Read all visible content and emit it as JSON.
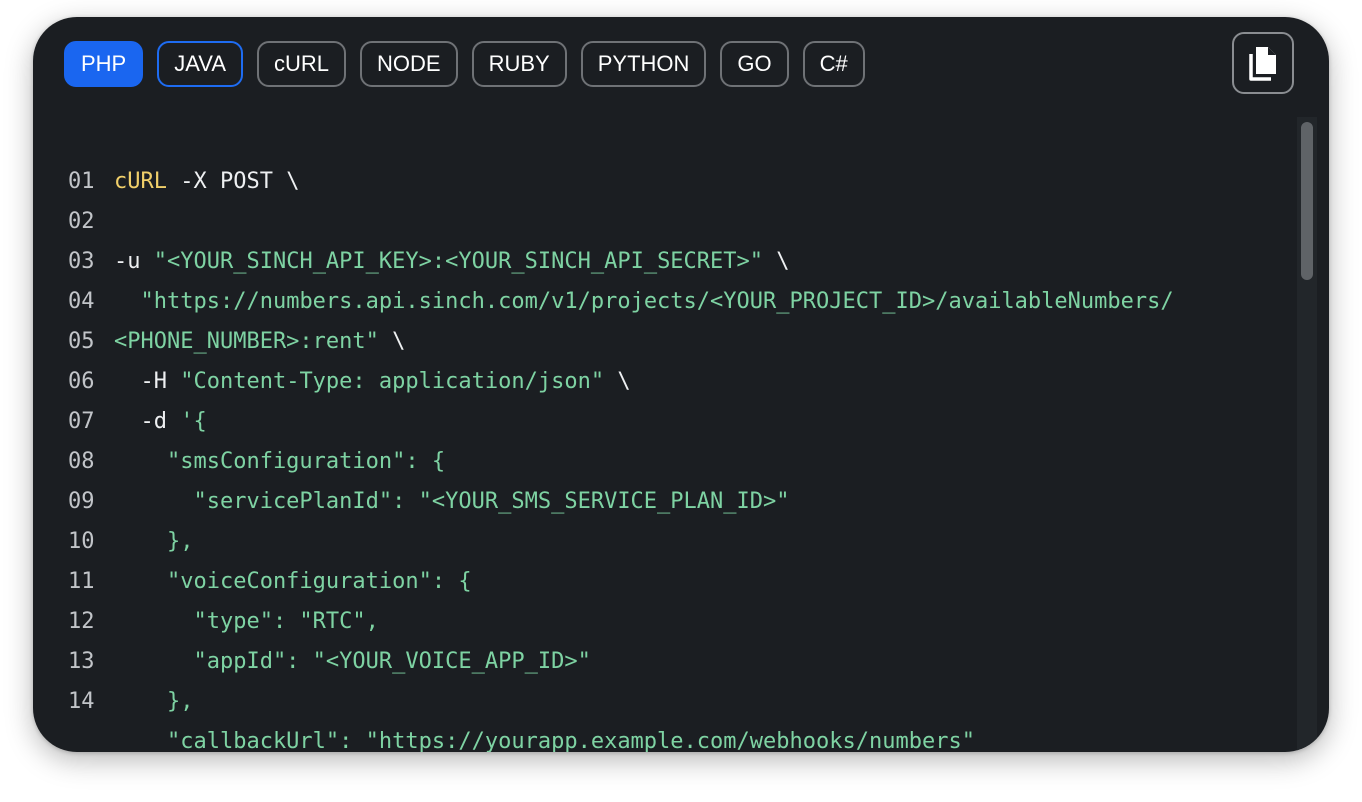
{
  "tabs": [
    {
      "label": "PHP",
      "state": "active"
    },
    {
      "label": "JAVA",
      "state": "focused"
    },
    {
      "label": "cURL",
      "state": "normal"
    },
    {
      "label": "NODE",
      "state": "normal"
    },
    {
      "label": "RUBY",
      "state": "normal"
    },
    {
      "label": "PYTHON",
      "state": "normal"
    },
    {
      "label": "GO",
      "state": "normal"
    },
    {
      "label": "C#",
      "state": "normal"
    }
  ],
  "copy_button": {
    "icon": "copy-icon"
  },
  "code": {
    "lines": [
      {
        "num": "01",
        "parts": [
          {
            "t": "cURL",
            "c": "kw"
          },
          {
            "t": " -X POST \\",
            "c": "plain"
          }
        ]
      },
      {
        "num": "02",
        "parts": []
      },
      {
        "num": "03",
        "parts": [
          {
            "t": "-u ",
            "c": "plain"
          },
          {
            "t": "\"<YOUR_SINCH_API_KEY>:<YOUR_SINCH_API_SECRET>\"",
            "c": "str"
          },
          {
            "t": " \\",
            "c": "plain"
          }
        ]
      },
      {
        "num": "04",
        "parts": [
          {
            "t": "  ",
            "c": "plain"
          },
          {
            "t": "\"https://numbers.api.sinch.com/v1/projects/<YOUR_PROJECT_ID>/availableNumbers/",
            "c": "str"
          }
        ]
      },
      {
        "num": "05",
        "parts": [
          {
            "t": "<PHONE_NUMBER>:rent\"",
            "c": "str"
          },
          {
            "t": " \\",
            "c": "plain"
          }
        ]
      },
      {
        "num": "06",
        "parts": [
          {
            "t": "  -H ",
            "c": "plain"
          },
          {
            "t": "\"Content-Type: application/json\"",
            "c": "str"
          },
          {
            "t": " \\",
            "c": "plain"
          }
        ]
      },
      {
        "num": "07",
        "parts": [
          {
            "t": "  -d ",
            "c": "plain"
          },
          {
            "t": "'{",
            "c": "str"
          }
        ]
      },
      {
        "num": "08",
        "parts": [
          {
            "t": "    \"smsConfiguration\": {",
            "c": "str"
          }
        ]
      },
      {
        "num": "09",
        "parts": [
          {
            "t": "      \"servicePlanId\": \"<YOUR_SMS_SERVICE_PLAN_ID>\"",
            "c": "str"
          }
        ]
      },
      {
        "num": "10",
        "parts": [
          {
            "t": "    },",
            "c": "str"
          }
        ]
      },
      {
        "num": "11",
        "parts": [
          {
            "t": "    \"voiceConfiguration\": {",
            "c": "str"
          }
        ]
      },
      {
        "num": "12",
        "parts": [
          {
            "t": "      \"type\": \"RTC\",",
            "c": "str"
          }
        ]
      },
      {
        "num": "13",
        "parts": [
          {
            "t": "      \"appId\": \"<YOUR_VOICE_APP_ID>\"",
            "c": "str"
          }
        ]
      },
      {
        "num": "14",
        "parts": [
          {
            "t": "    },",
            "c": "str"
          }
        ]
      },
      {
        "num": "",
        "parts": [
          {
            "t": "    \"callbackUrl\": \"https://yourapp.example.com/webhooks/numbers\"",
            "c": "str"
          }
        ]
      }
    ]
  },
  "colors": {
    "background": "#1b1e22",
    "active_tab": "#1a66f0",
    "keyword": "#f0cf6a",
    "string": "#7ed3a3",
    "text": "#eef0f2"
  }
}
